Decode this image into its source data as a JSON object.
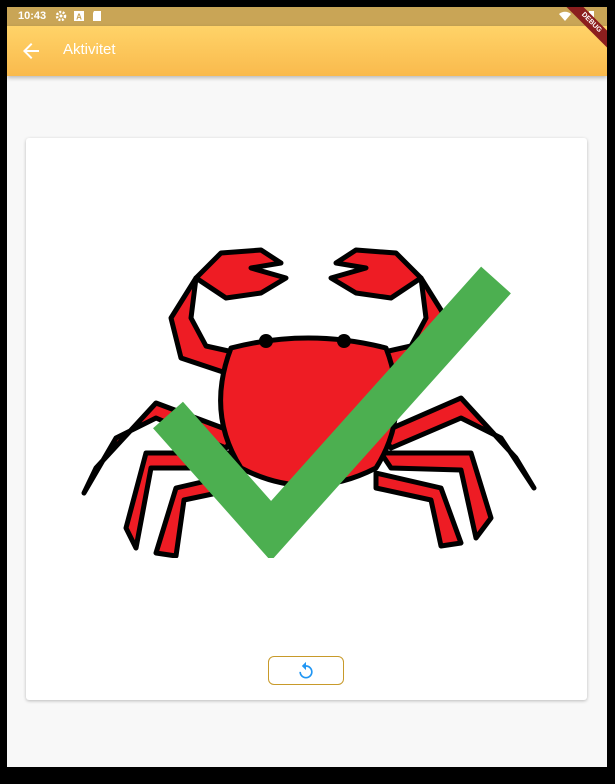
{
  "status_bar": {
    "time": "10:43",
    "left_icons": [
      "settings-icon",
      "a-badge-icon",
      "sd-card-icon"
    ],
    "right_icons": [
      "wifi-icon",
      "battery-icon"
    ]
  },
  "app_bar": {
    "title": "Aktivitet",
    "back_icon": "arrow-back-icon",
    "debug_banner": "DEBUG"
  },
  "card": {
    "image_subject": "crab-icon",
    "overlay": "checkmark-icon",
    "reset_button_icon": "refresh-icon"
  },
  "colors": {
    "status_bar": "#c9a556",
    "app_bar": "#f9ba4d",
    "crab_red": "#ee1c24",
    "check_green": "#4caf50",
    "button_border": "#c89a2a",
    "button_icon": "#2196f3"
  }
}
